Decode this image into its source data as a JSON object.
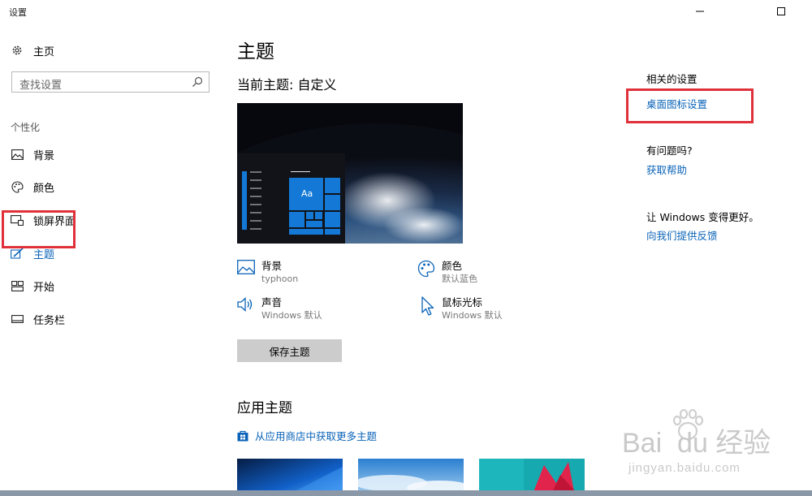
{
  "window": {
    "title": "设置"
  },
  "sidebar": {
    "home_label": "主页",
    "search_placeholder": "查找设置",
    "section_label": "个性化",
    "items": [
      {
        "label": "背景",
        "icon": "image-icon"
      },
      {
        "label": "颜色",
        "icon": "palette-icon"
      },
      {
        "label": "锁屏界面",
        "icon": "lock-screen-icon"
      },
      {
        "label": "主题",
        "icon": "theme-brush-icon",
        "active": true
      },
      {
        "label": "开始",
        "icon": "start-grid-icon"
      },
      {
        "label": "任务栏",
        "icon": "taskbar-icon"
      }
    ]
  },
  "main": {
    "title": "主题",
    "current_theme": "当前主题: 自定义",
    "preview_sample_text": "Aa",
    "theme_items": [
      {
        "title": "背景",
        "value": "typhoon",
        "icon": "image-icon"
      },
      {
        "title": "颜色",
        "value": "默认蓝色",
        "icon": "palette-icon"
      },
      {
        "title": "声音",
        "value": "Windows 默认",
        "icon": "speaker-icon"
      },
      {
        "title": "鼠标光标",
        "value": "Windows 默认",
        "icon": "cursor-icon"
      }
    ],
    "save_button": "保存主题",
    "apply_title": "应用主题",
    "store_link": "从应用商店中获取更多主题"
  },
  "related": {
    "heading": "相关的设置",
    "desktop_icons_link": "桌面图标设置",
    "help_heading": "有问题吗?",
    "help_link": "获取帮助",
    "feedback_heading": "让 Windows 变得更好。",
    "feedback_link": "向我们提供反馈"
  },
  "watermark": {
    "brand": "Bai  du 经验",
    "url": "jingyan.baidu.com"
  },
  "colors": {
    "accent": "#0a63b8",
    "tile_blue": "#1479d6",
    "highlight_red": "#e0313b"
  }
}
